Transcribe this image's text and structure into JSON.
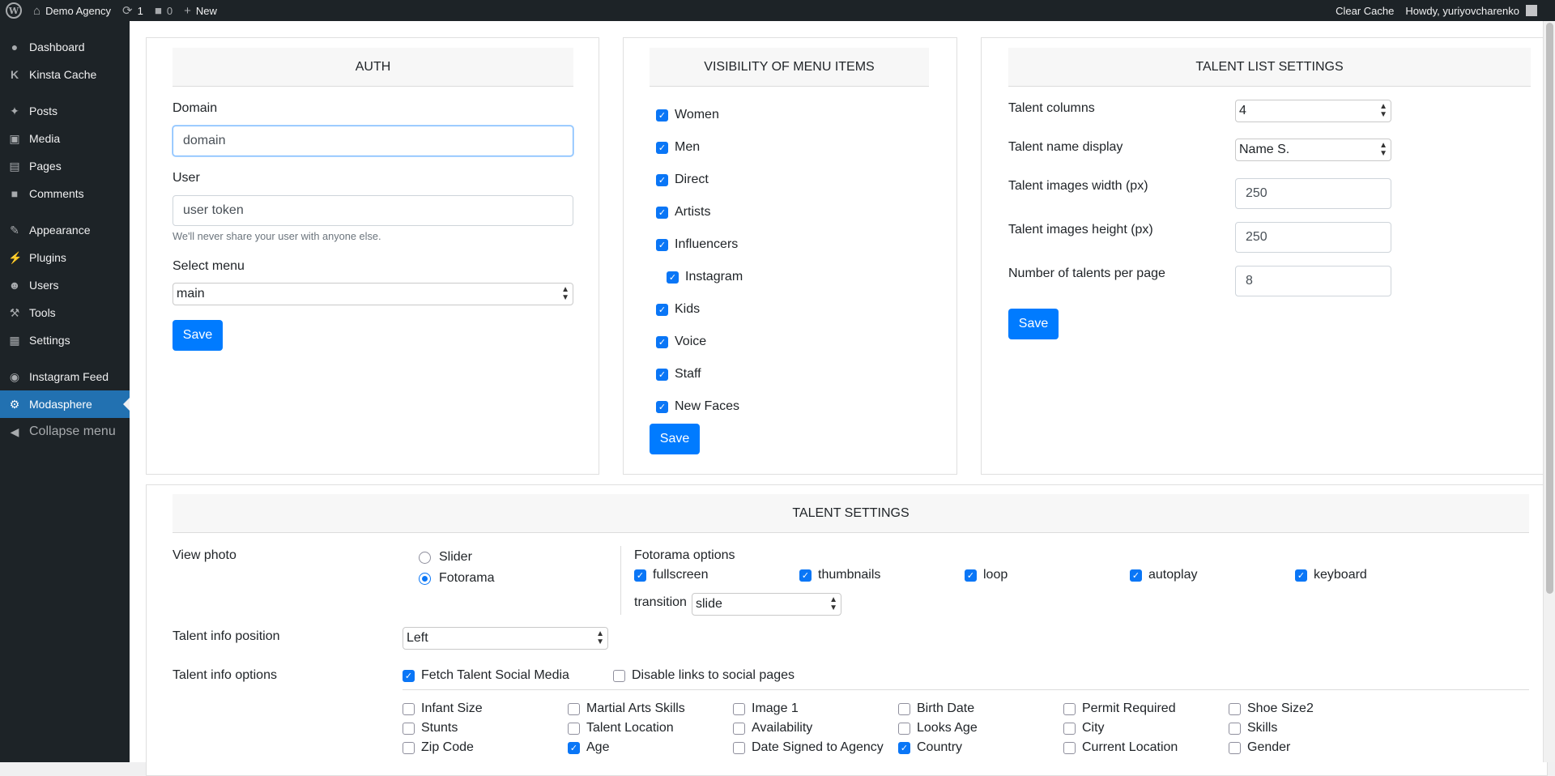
{
  "adminbar": {
    "site_name": "Demo Agency",
    "updates_count": "1",
    "comments_count": "0",
    "new_label": "New",
    "clear_cache": "Clear Cache",
    "howdy": "Howdy, yuriyovcharenko"
  },
  "sidebar": {
    "items": [
      {
        "label": "Dashboard",
        "icon": "dashboard-icon"
      },
      {
        "label": "Kinsta Cache",
        "icon": "kinsta-icon"
      },
      {
        "label": "Posts",
        "icon": "pin-icon"
      },
      {
        "label": "Media",
        "icon": "media-icon"
      },
      {
        "label": "Pages",
        "icon": "pages-icon"
      },
      {
        "label": "Comments",
        "icon": "comment-icon"
      },
      {
        "label": "Appearance",
        "icon": "brush-icon"
      },
      {
        "label": "Plugins",
        "icon": "plug-icon"
      },
      {
        "label": "Users",
        "icon": "user-icon"
      },
      {
        "label": "Tools",
        "icon": "wrench-icon"
      },
      {
        "label": "Settings",
        "icon": "settings-icon"
      },
      {
        "label": "Instagram Feed",
        "icon": "camera-icon"
      },
      {
        "label": "Modasphere",
        "icon": "gear-icon"
      },
      {
        "label": "Collapse menu",
        "icon": "collapse-icon"
      }
    ]
  },
  "auth": {
    "title": "AUTH",
    "domain_label": "Domain",
    "domain_value": "domain",
    "user_label": "User",
    "user_value": "user token",
    "user_help": "We'll never share your user with anyone else.",
    "select_menu_label": "Select menu",
    "select_menu_value": "main",
    "save": "Save"
  },
  "visibility": {
    "title": "VISIBILITY OF MENU ITEMS",
    "items": [
      {
        "label": "Women",
        "checked": true
      },
      {
        "label": "Men",
        "checked": true
      },
      {
        "label": "Direct",
        "checked": true
      },
      {
        "label": "Artists",
        "checked": true
      },
      {
        "label": "Influencers",
        "checked": true
      },
      {
        "label": "Instagram",
        "checked": true
      },
      {
        "label": "Kids",
        "checked": true
      },
      {
        "label": "Voice",
        "checked": true
      },
      {
        "label": "Staff",
        "checked": true
      },
      {
        "label": "New Faces",
        "checked": true
      }
    ],
    "save": "Save"
  },
  "talent_list": {
    "title": "TALENT LIST SETTINGS",
    "columns_label": "Talent columns",
    "columns_value": "4",
    "name_display_label": "Talent name display",
    "name_display_value": "Name S.",
    "width_label": "Talent images width (px)",
    "width_value": "250",
    "height_label": "Talent images height (px)",
    "height_value": "250",
    "per_page_label": "Number of talents per page",
    "per_page_value": "8",
    "save": "Save"
  },
  "talent_settings": {
    "title": "TALENT SETTINGS",
    "view_photo_label": "View photo",
    "radio_slider": "Slider",
    "radio_fotorama": "Fotorama",
    "fotorama_title": "Fotorama options",
    "fotorama_options": [
      {
        "label": "fullscreen",
        "checked": true
      },
      {
        "label": "thumbnails",
        "checked": true
      },
      {
        "label": "loop",
        "checked": true
      },
      {
        "label": "autoplay",
        "checked": true
      },
      {
        "label": "keyboard",
        "checked": true
      }
    ],
    "transition_label": "transition",
    "transition_value": "slide",
    "info_position_label": "Talent info position",
    "info_position_value": "Left",
    "info_options_label": "Talent info options",
    "fetch_social": "Fetch Talent Social Media",
    "disable_links": "Disable links to social pages",
    "fields": [
      {
        "label": "Infant Size",
        "checked": false
      },
      {
        "label": "Martial Arts Skills",
        "checked": false
      },
      {
        "label": "Image 1",
        "checked": false
      },
      {
        "label": "Birth Date",
        "checked": false
      },
      {
        "label": "Permit Required",
        "checked": false
      },
      {
        "label": "Shoe Size2",
        "checked": false
      },
      {
        "label": "Stunts",
        "checked": false
      },
      {
        "label": "Talent Location",
        "checked": false
      },
      {
        "label": "Availability",
        "checked": false
      },
      {
        "label": "Looks Age",
        "checked": false
      },
      {
        "label": "City",
        "checked": false
      },
      {
        "label": "Skills",
        "checked": false
      },
      {
        "label": "Zip Code",
        "checked": false
      },
      {
        "label": "Age",
        "checked": true
      },
      {
        "label": "Date Signed to Agency",
        "checked": false
      },
      {
        "label": "Country",
        "checked": true
      },
      {
        "label": "Current Location",
        "checked": false
      },
      {
        "label": "Gender",
        "checked": false
      }
    ]
  }
}
